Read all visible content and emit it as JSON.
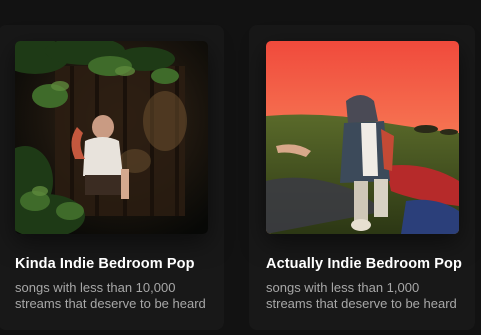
{
  "playlists": [
    {
      "title": "Kinda Indie Bedroom Pop",
      "description": "songs with less than 10,000 streams that deserve to be heard"
    },
    {
      "title": "Actually Indie Bedroom Pop",
      "description": "songs with less than 1,000 streams that deserve to be heard"
    }
  ],
  "colors": {
    "background": "#121212",
    "card": "#181818",
    "title": "#ffffff",
    "description": "#a7a7a7"
  }
}
